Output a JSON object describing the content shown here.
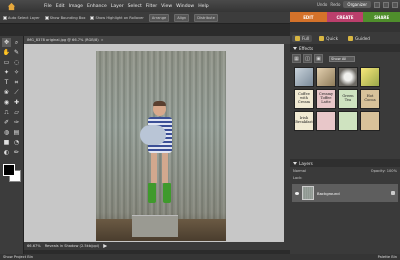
{
  "menubar": {
    "items": [
      "File",
      "Edit",
      "Image",
      "Enhance",
      "Layer",
      "Select",
      "Filter",
      "View",
      "Window",
      "Help"
    ],
    "undo_label": "Undo",
    "redo_label": "Redo",
    "organizer_label": "Organizer"
  },
  "options_bar": {
    "auto_select_label": "Auto Select Layer",
    "bounding_box_label": "Show Bounding Box",
    "highlight_label": "Show Highlight on Rollover",
    "arrange_label": "Arrange",
    "align_label": "Align",
    "distribute_label": "Distribute"
  },
  "mode_tabs": [
    {
      "label": "EDIT",
      "color": "#d4722a"
    },
    {
      "label": "CREATE",
      "color": "#bb3f6c"
    },
    {
      "label": "SHARE",
      "color": "#4f8e2c"
    }
  ],
  "sub_tabs": [
    "Full",
    "Quick",
    "Guided"
  ],
  "document": {
    "tab_title": "IMG_8378 original.jpg @ 66.7% (RGB/8)",
    "zoom": "66.67%",
    "status_text": "Reveals in Shadow (2.5kb/ppi)"
  },
  "effects_panel": {
    "title": "Effects",
    "filter_select": "Show All",
    "thumbnails": [
      {
        "label": ""
      },
      {
        "label": ""
      },
      {
        "label": ""
      },
      {
        "label": ""
      },
      {
        "label": "Coffee with Cream"
      },
      {
        "label": "Creamy Toffee Latte"
      },
      {
        "label": "Green Tea"
      },
      {
        "label": "Hot Cocoa"
      },
      {
        "label": "Irish Breakfast"
      },
      {
        "label": ""
      },
      {
        "label": ""
      },
      {
        "label": ""
      }
    ]
  },
  "layers_panel": {
    "title": "Layers",
    "blend_mode": "Normal",
    "opacity_label": "Opacity:",
    "opacity_value": "100%",
    "lock_label": "Lock:",
    "layer_name": "Background"
  },
  "bottom_bar": {
    "project_bin_label": "Show Project Bin",
    "palette_bin_label": "Palette Bin"
  }
}
